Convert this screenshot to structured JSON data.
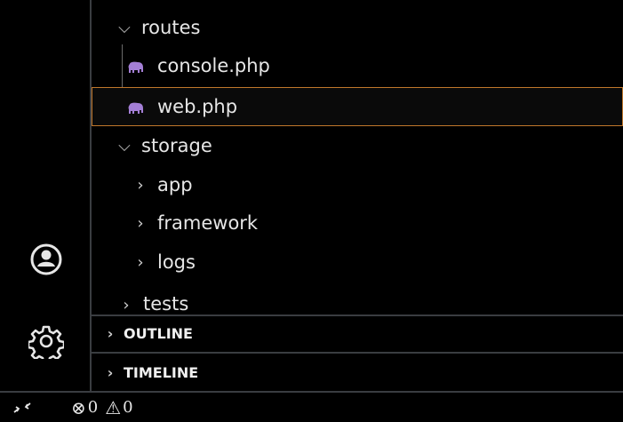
{
  "activity_bar": {
    "items": [
      {
        "name": "accounts",
        "icon": "account-icon"
      },
      {
        "name": "manage",
        "icon": "gear-icon"
      }
    ]
  },
  "explorer": {
    "tree": [
      {
        "label": "routes",
        "type": "folder",
        "expanded": true
      },
      {
        "label": "console.php",
        "type": "file",
        "icon": "php-elephant-icon"
      },
      {
        "label": "web.php",
        "type": "file",
        "icon": "php-elephant-icon",
        "selected": true
      },
      {
        "label": "storage",
        "type": "folder",
        "expanded": true
      },
      {
        "label": "app",
        "type": "folder",
        "expanded": false
      },
      {
        "label": "framework",
        "type": "folder",
        "expanded": false
      },
      {
        "label": "logs",
        "type": "folder",
        "expanded": false
      },
      {
        "label": "tests",
        "type": "folder",
        "expanded": false
      }
    ],
    "sections": [
      {
        "label": "OUTLINE",
        "expanded": false
      },
      {
        "label": "TIMELINE",
        "expanded": false
      }
    ]
  },
  "status_bar": {
    "remote_icon": "remote-icon",
    "errors": "0",
    "warnings": "0"
  },
  "colors": {
    "background": "#000000",
    "border": "#3a3d41",
    "selection_border": "#c0772b",
    "php_icon": "#a47fd6"
  }
}
